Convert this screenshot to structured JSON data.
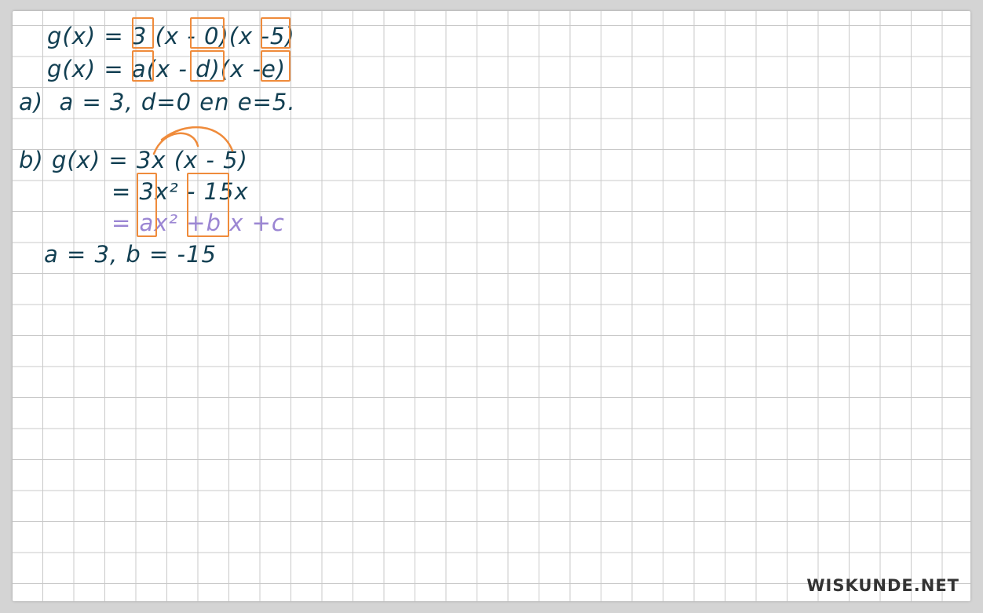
{
  "lines": {
    "l1": "g(x) = 3 (x - 0)(x -5)",
    "l2": "g(x) = a(x - d)(x -e)",
    "l3": "a)  a = 3, d=0 en e=5.",
    "l4": "b) g(x) = 3x (x - 5)",
    "l5": "= 3x² - 15x",
    "l6": "= ax² +b x +c",
    "l7": "a = 3, b = -15"
  },
  "logo": "WISKUNDE.NET",
  "colors": {
    "ink": "#123f52",
    "teal": "#1d8f9a",
    "box": "#ef8b3b",
    "purple": "#9b86d3",
    "grid": "#c9c9c9"
  }
}
